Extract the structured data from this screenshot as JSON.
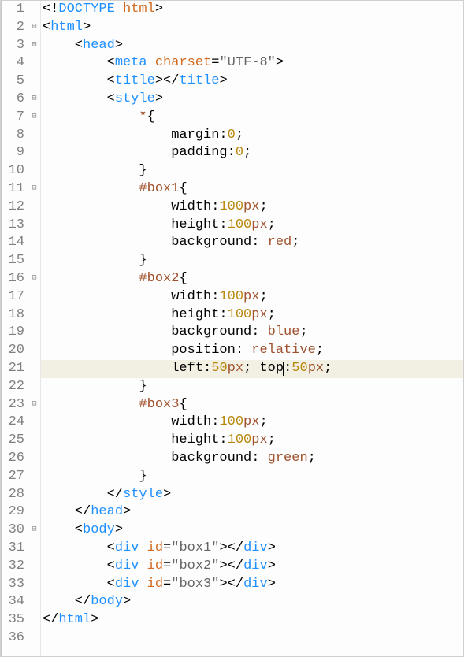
{
  "editor": {
    "highlighted_line": 21,
    "lines": [
      {
        "num": 1,
        "fold": "",
        "tokens": [
          [
            "punct",
            "<!"
          ],
          [
            "html-blue",
            "DOCTYPE"
          ],
          [
            "punct",
            " "
          ],
          [
            "attr-name",
            "html"
          ],
          [
            "punct",
            ">"
          ]
        ]
      },
      {
        "num": 2,
        "fold": "⊟",
        "tokens": [
          [
            "punct",
            "<"
          ],
          [
            "html-blue",
            "html"
          ],
          [
            "punct",
            ">"
          ]
        ]
      },
      {
        "num": 3,
        "fold": "⊟",
        "tokens": [
          [
            "punct",
            "    <"
          ],
          [
            "html-blue",
            "head"
          ],
          [
            "punct",
            ">"
          ]
        ]
      },
      {
        "num": 4,
        "fold": "",
        "tokens": [
          [
            "punct",
            "        <"
          ],
          [
            "html-blue",
            "meta"
          ],
          [
            "punct",
            " "
          ],
          [
            "attr-name",
            "charset"
          ],
          [
            "punct",
            "="
          ],
          [
            "gray",
            "\"UTF-8\""
          ],
          [
            "punct",
            ">"
          ]
        ]
      },
      {
        "num": 5,
        "fold": "",
        "tokens": [
          [
            "punct",
            "        <"
          ],
          [
            "html-blue",
            "title"
          ],
          [
            "punct",
            "></"
          ],
          [
            "html-blue",
            "title"
          ],
          [
            "punct",
            ">"
          ]
        ]
      },
      {
        "num": 6,
        "fold": "⊟",
        "tokens": [
          [
            "punct",
            "        <"
          ],
          [
            "html-blue",
            "style"
          ],
          [
            "punct",
            ">"
          ]
        ]
      },
      {
        "num": 7,
        "fold": "⊟",
        "tokens": [
          [
            "punct",
            "            "
          ],
          [
            "sel",
            "*"
          ],
          [
            "punct",
            "{"
          ]
        ]
      },
      {
        "num": 8,
        "fold": "",
        "tokens": [
          [
            "punct",
            "                margin:"
          ],
          [
            "kw",
            "0"
          ],
          [
            "punct",
            ";"
          ]
        ]
      },
      {
        "num": 9,
        "fold": "",
        "tokens": [
          [
            "punct",
            "                padding:"
          ],
          [
            "kw",
            "0"
          ],
          [
            "punct",
            ";"
          ]
        ]
      },
      {
        "num": 10,
        "fold": "",
        "tokens": [
          [
            "punct",
            "            }"
          ]
        ]
      },
      {
        "num": 11,
        "fold": "⊟",
        "tokens": [
          [
            "punct",
            "            "
          ],
          [
            "id-sel",
            "#box1"
          ],
          [
            "punct",
            "{"
          ]
        ]
      },
      {
        "num": 12,
        "fold": "",
        "tokens": [
          [
            "punct",
            "                width:"
          ],
          [
            "kw",
            "100"
          ],
          [
            "sel",
            "px"
          ],
          [
            "punct",
            ";"
          ]
        ]
      },
      {
        "num": 13,
        "fold": "",
        "tokens": [
          [
            "punct",
            "                height:"
          ],
          [
            "kw",
            "100"
          ],
          [
            "sel",
            "px"
          ],
          [
            "punct",
            ";"
          ]
        ]
      },
      {
        "num": 14,
        "fold": "",
        "tokens": [
          [
            "punct",
            "                background: "
          ],
          [
            "sel",
            "red"
          ],
          [
            "punct",
            ";"
          ]
        ]
      },
      {
        "num": 15,
        "fold": "",
        "tokens": [
          [
            "punct",
            "            }"
          ]
        ]
      },
      {
        "num": 16,
        "fold": "⊟",
        "tokens": [
          [
            "punct",
            "            "
          ],
          [
            "id-sel",
            "#box2"
          ],
          [
            "punct",
            "{"
          ]
        ]
      },
      {
        "num": 17,
        "fold": "",
        "tokens": [
          [
            "punct",
            "                width:"
          ],
          [
            "kw",
            "100"
          ],
          [
            "sel",
            "px"
          ],
          [
            "punct",
            ";"
          ]
        ]
      },
      {
        "num": 18,
        "fold": "",
        "tokens": [
          [
            "punct",
            "                height:"
          ],
          [
            "kw",
            "100"
          ],
          [
            "sel",
            "px"
          ],
          [
            "punct",
            ";"
          ]
        ]
      },
      {
        "num": 19,
        "fold": "",
        "tokens": [
          [
            "punct",
            "                background: "
          ],
          [
            "sel",
            "blue"
          ],
          [
            "punct",
            ";"
          ]
        ]
      },
      {
        "num": 20,
        "fold": "",
        "tokens": [
          [
            "punct",
            "                position: "
          ],
          [
            "sel",
            "relative"
          ],
          [
            "punct",
            ";"
          ]
        ]
      },
      {
        "num": 21,
        "fold": "",
        "tokens": [
          [
            "punct",
            "                left:"
          ],
          [
            "kw",
            "50"
          ],
          [
            "sel",
            "px"
          ],
          [
            "punct",
            "; top"
          ],
          [
            "cursor",
            ""
          ],
          [
            "punct",
            ":"
          ],
          [
            "kw",
            "50"
          ],
          [
            "sel",
            "px"
          ],
          [
            "punct",
            ";"
          ]
        ]
      },
      {
        "num": 22,
        "fold": "",
        "tokens": [
          [
            "punct",
            "            }"
          ]
        ]
      },
      {
        "num": 23,
        "fold": "⊟",
        "tokens": [
          [
            "punct",
            "            "
          ],
          [
            "id-sel",
            "#box3"
          ],
          [
            "punct",
            "{"
          ]
        ]
      },
      {
        "num": 24,
        "fold": "",
        "tokens": [
          [
            "punct",
            "                width:"
          ],
          [
            "kw",
            "100"
          ],
          [
            "sel",
            "px"
          ],
          [
            "punct",
            ";"
          ]
        ]
      },
      {
        "num": 25,
        "fold": "",
        "tokens": [
          [
            "punct",
            "                height:"
          ],
          [
            "kw",
            "100"
          ],
          [
            "sel",
            "px"
          ],
          [
            "punct",
            ";"
          ]
        ]
      },
      {
        "num": 26,
        "fold": "",
        "tokens": [
          [
            "punct",
            "                background: "
          ],
          [
            "sel",
            "green"
          ],
          [
            "punct",
            ";"
          ]
        ]
      },
      {
        "num": 27,
        "fold": "",
        "tokens": [
          [
            "punct",
            "            }"
          ]
        ]
      },
      {
        "num": 28,
        "fold": "",
        "tokens": [
          [
            "punct",
            "        </"
          ],
          [
            "html-blue",
            "style"
          ],
          [
            "punct",
            ">"
          ]
        ]
      },
      {
        "num": 29,
        "fold": "",
        "tokens": [
          [
            "punct",
            "    </"
          ],
          [
            "html-blue",
            "head"
          ],
          [
            "punct",
            ">"
          ]
        ]
      },
      {
        "num": 30,
        "fold": "⊟",
        "tokens": [
          [
            "punct",
            "    <"
          ],
          [
            "html-blue",
            "body"
          ],
          [
            "punct",
            ">"
          ]
        ]
      },
      {
        "num": 31,
        "fold": "",
        "tokens": [
          [
            "punct",
            "        <"
          ],
          [
            "html-blue",
            "div"
          ],
          [
            "punct",
            " "
          ],
          [
            "attr-name",
            "id"
          ],
          [
            "punct",
            "="
          ],
          [
            "gray",
            "\"box1\""
          ],
          [
            "punct",
            "></"
          ],
          [
            "html-blue",
            "div"
          ],
          [
            "punct",
            ">"
          ]
        ]
      },
      {
        "num": 32,
        "fold": "",
        "tokens": [
          [
            "punct",
            "        <"
          ],
          [
            "html-blue",
            "div"
          ],
          [
            "punct",
            " "
          ],
          [
            "attr-name",
            "id"
          ],
          [
            "punct",
            "="
          ],
          [
            "gray",
            "\"box2\""
          ],
          [
            "punct",
            "></"
          ],
          [
            "html-blue",
            "div"
          ],
          [
            "punct",
            ">"
          ]
        ]
      },
      {
        "num": 33,
        "fold": "",
        "tokens": [
          [
            "punct",
            "        <"
          ],
          [
            "html-blue",
            "div"
          ],
          [
            "punct",
            " "
          ],
          [
            "attr-name",
            "id"
          ],
          [
            "punct",
            "="
          ],
          [
            "gray",
            "\"box3\""
          ],
          [
            "punct",
            "></"
          ],
          [
            "html-blue",
            "div"
          ],
          [
            "punct",
            ">"
          ]
        ]
      },
      {
        "num": 34,
        "fold": "",
        "tokens": [
          [
            "punct",
            "    </"
          ],
          [
            "html-blue",
            "body"
          ],
          [
            "punct",
            ">"
          ]
        ]
      },
      {
        "num": 35,
        "fold": "",
        "tokens": [
          [
            "punct",
            "</"
          ],
          [
            "html-blue",
            "html"
          ],
          [
            "punct",
            ">"
          ]
        ]
      },
      {
        "num": 36,
        "fold": "",
        "tokens": [
          [
            "punct",
            ""
          ]
        ]
      }
    ]
  }
}
